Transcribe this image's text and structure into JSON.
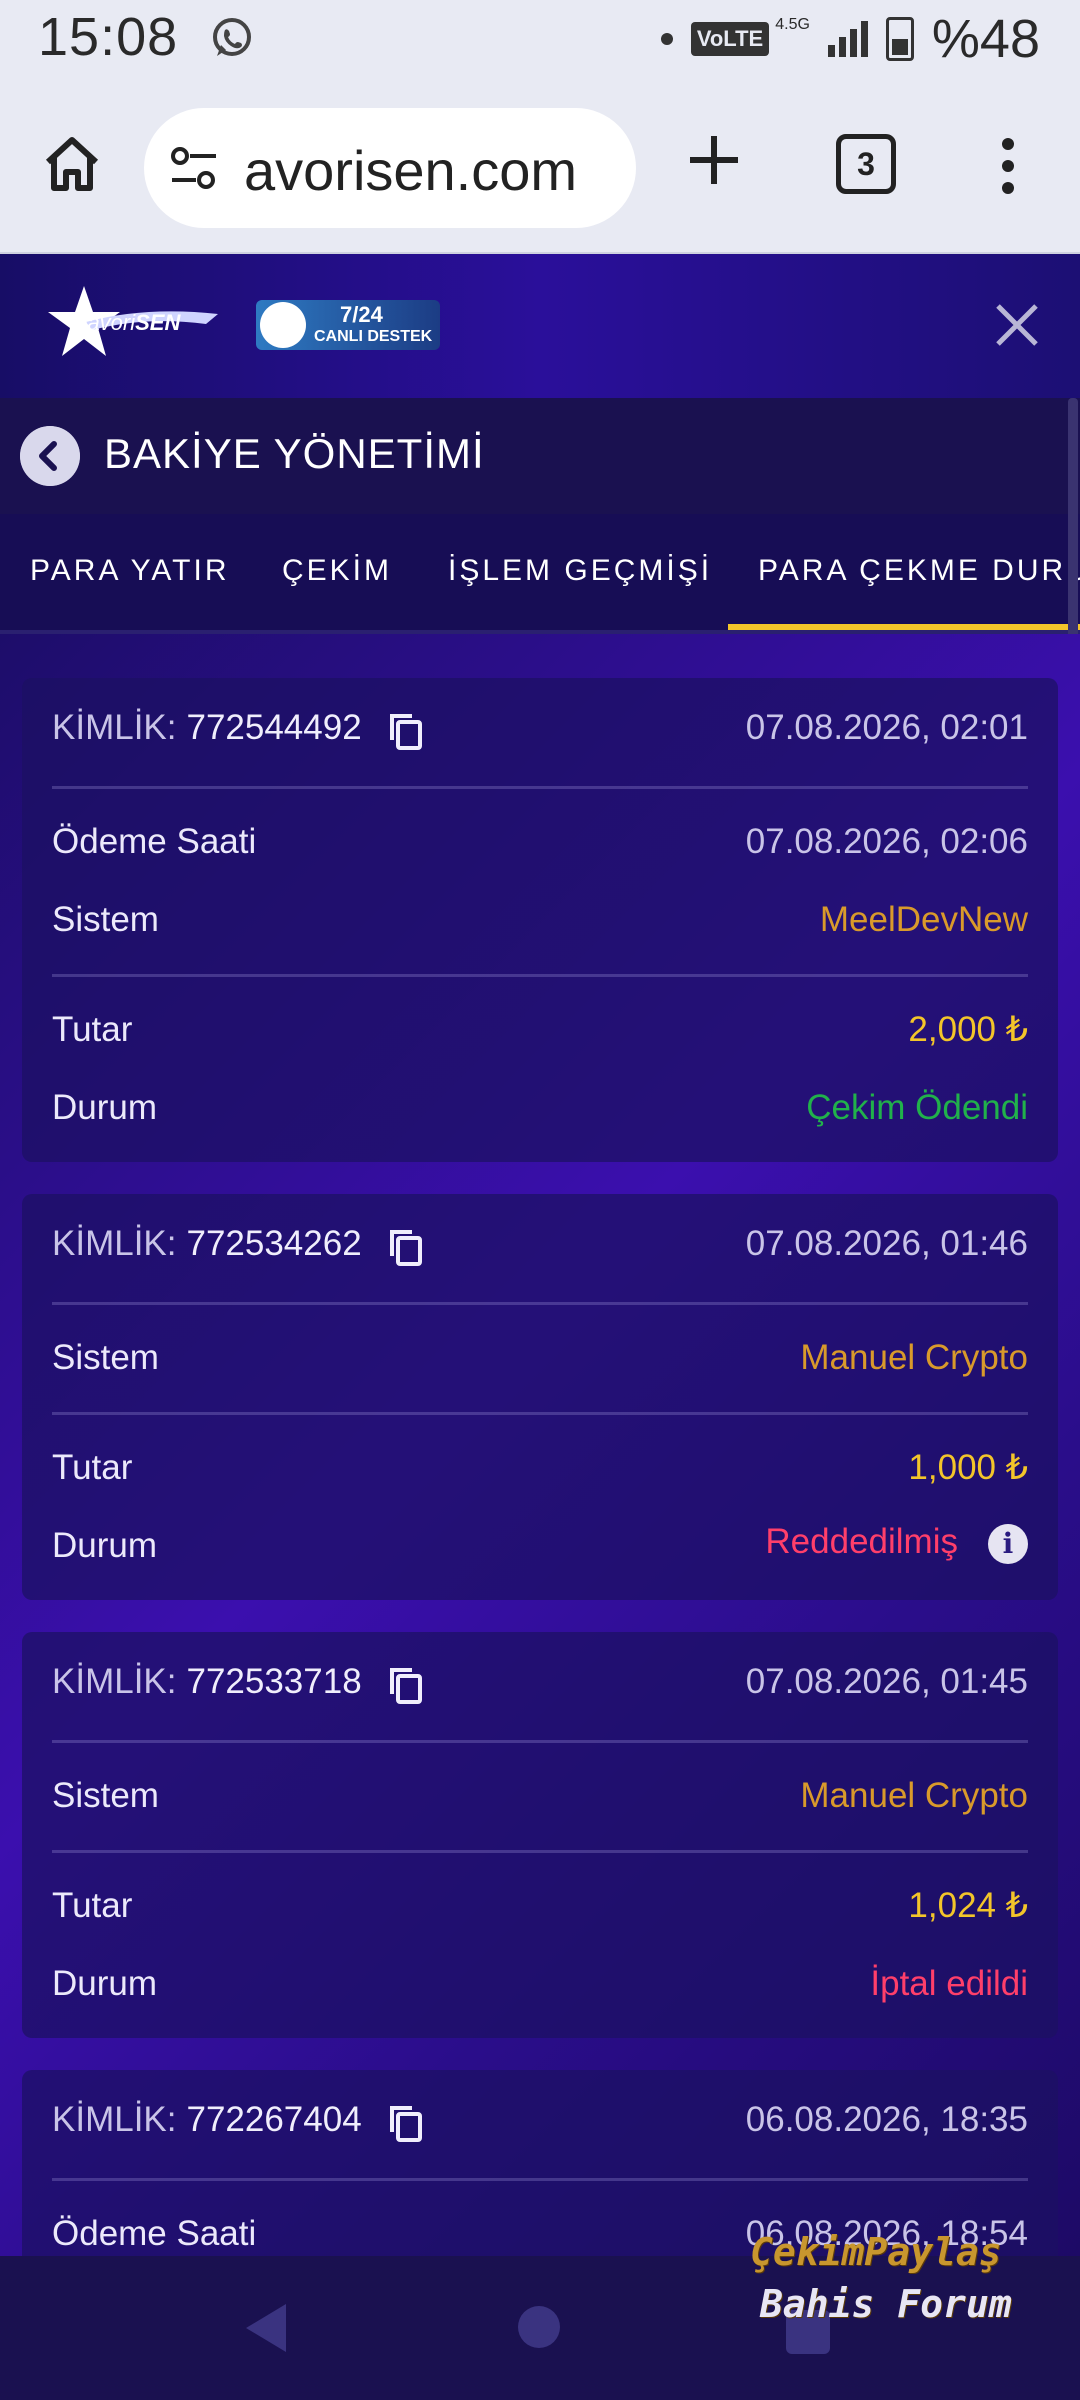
{
  "status_bar": {
    "time": "15:08",
    "network": "VoLTE",
    "network_gen": "4.5G",
    "battery": "%48"
  },
  "browser": {
    "url": "avorisen.com",
    "tab_count": "3"
  },
  "site": {
    "logo_text_1": "Favori",
    "logo_text_2": "SEN",
    "support_hours": "7/24",
    "support_label": "CANLI DESTEK"
  },
  "page": {
    "title": "BAKİYE YÖNETİMİ"
  },
  "tabs": [
    {
      "label": "PARA YATIR"
    },
    {
      "label": "ÇEKİM"
    },
    {
      "label": "İŞLEM GEÇMİŞİ"
    },
    {
      "label": "PARA ÇEKME DURUMU",
      "active": true
    }
  ],
  "labels": {
    "id": "KİMLİK:",
    "payment_time": "Ödeme Saati",
    "system": "Sistem",
    "amount": "Tutar",
    "status": "Durum"
  },
  "withdrawals": [
    {
      "id": "772544492",
      "date": "07.08.2026, 02:01",
      "payment_time": "07.08.2026, 02:06",
      "system": "MeelDevNew",
      "amount": "2,000 ₺",
      "status": "Çekim Ödendi"
    },
    {
      "id": "772534262",
      "date": "07.08.2026, 01:46",
      "system": "Manuel Crypto",
      "amount": "1,000 ₺",
      "status": "Reddedilmiş"
    },
    {
      "id": "772533718",
      "date": "07.08.2026, 01:45",
      "system": "Manuel Crypto",
      "amount": "1,024 ₺",
      "status": "İptal edildi"
    },
    {
      "id": "772267404",
      "date": "06.08.2026, 18:35",
      "payment_time": "06.08.2026, 18:54"
    }
  ],
  "watermark": {
    "line1": "ÇekimPaylaş",
    "line2": "Bahis Forum"
  },
  "colors": {
    "amount": "#f3c52a",
    "system": "#d99a2b",
    "paid": "#21b14b",
    "rejected": "#ff3f6a",
    "tab_active": "#f3c52a"
  }
}
